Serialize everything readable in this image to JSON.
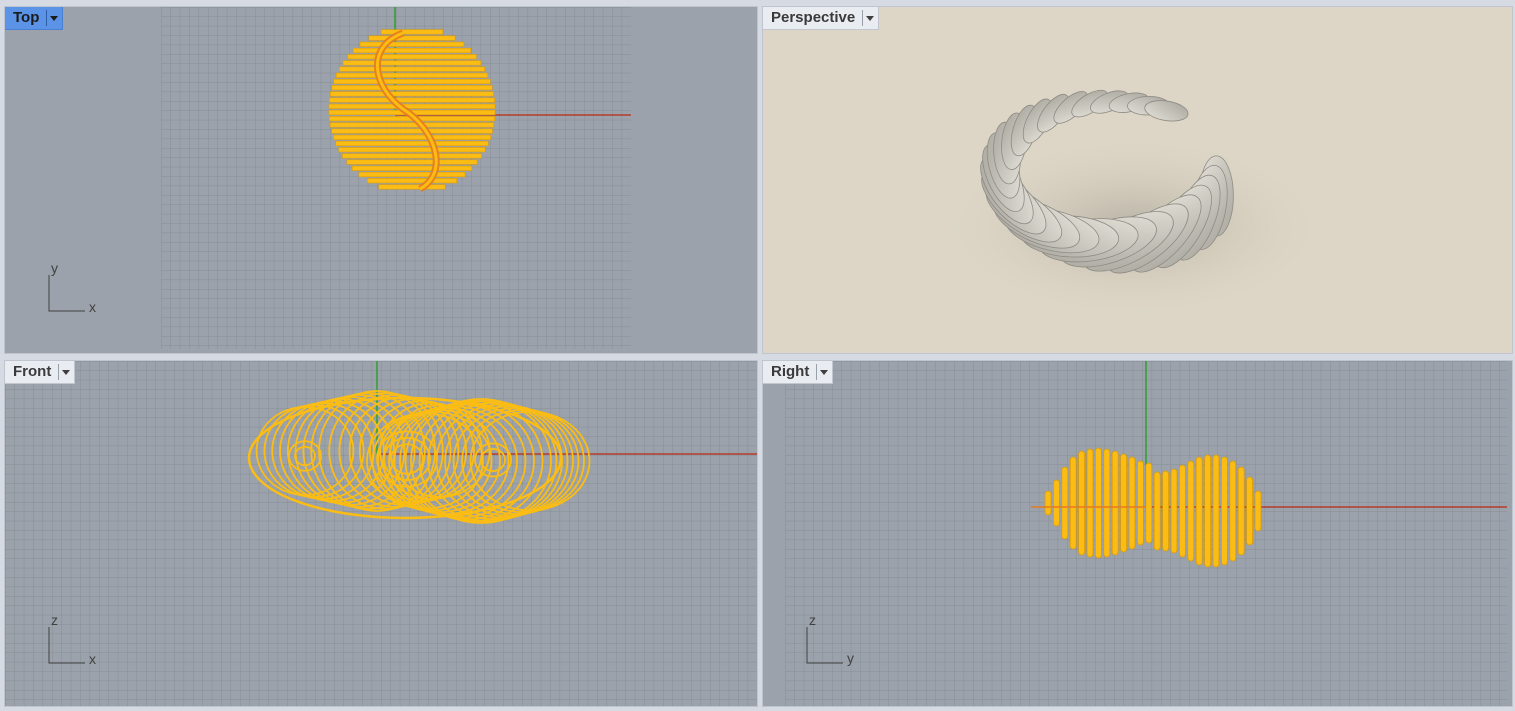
{
  "viewports": {
    "top": {
      "title": "Top",
      "axis_h": "x",
      "axis_v": "y"
    },
    "perspective": {
      "title": "Perspective"
    },
    "front": {
      "title": "Front",
      "axis_h": "x",
      "axis_v": "z"
    },
    "right": {
      "title": "Right",
      "axis_h": "y",
      "axis_v": "z"
    }
  },
  "active_viewport": "Top",
  "colors": {
    "viewport_bg": "#9ba2ab",
    "grid_minor": "#8c939c",
    "grid_major": "#7d848d",
    "x_axis": "#b43c2d",
    "y_axis": "#2ea02e",
    "wireframe": "#fbbd14",
    "selection_edge": "#e77b1e",
    "render_bg": "#ddd6c6",
    "render_ribs": "#c9c6bd"
  },
  "icons": {
    "viewport_menu": "chevron-down-icon"
  }
}
